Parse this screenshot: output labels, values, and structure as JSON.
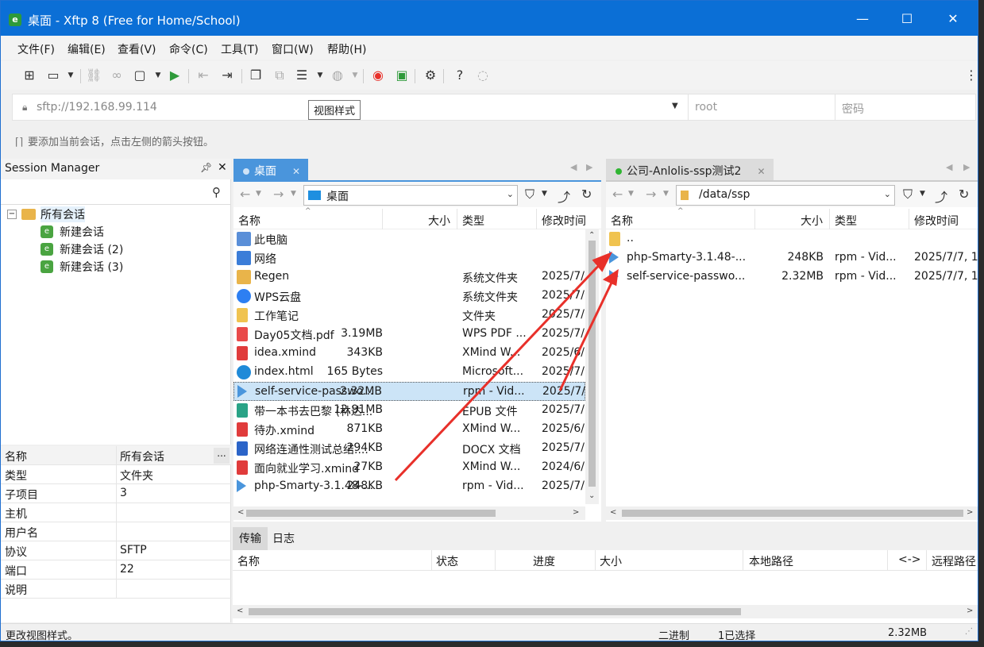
{
  "window": {
    "title": "桌面 - Xftp 8 (Free for Home/School)",
    "minimize": "—",
    "maximize": "☐",
    "close": "✕"
  },
  "menu": [
    "文件(F)",
    "编辑(E)",
    "查看(V)",
    "命令(C)",
    "工具(T)",
    "窗口(W)",
    "帮助(H)"
  ],
  "toolbar": {
    "tooltip": "视图样式"
  },
  "address": {
    "host": "sftp://192.168.99.114",
    "user_placeholder": "root",
    "password_placeholder": "密码"
  },
  "hint": "要添加当前会话，点击左侧的箭头按钮。",
  "session_manager": {
    "title": "Session Manager",
    "tree": {
      "root": "所有会话",
      "items": [
        "新建会话",
        "新建会话 (2)",
        "新建会话 (3)"
      ]
    }
  },
  "properties": {
    "header": {
      "key": "名称",
      "value": "所有会话",
      "more": "..."
    },
    "rows": [
      {
        "key": "类型",
        "value": "文件夹"
      },
      {
        "key": "子项目",
        "value": "3"
      },
      {
        "key": "主机",
        "value": ""
      },
      {
        "key": "用户名",
        "value": ""
      },
      {
        "key": "协议",
        "value": "SFTP"
      },
      {
        "key": "端口",
        "value": "22"
      },
      {
        "key": "说明",
        "value": ""
      }
    ]
  },
  "local": {
    "tab": "桌面",
    "path": "桌面",
    "columns": [
      "名称",
      "大小",
      "类型",
      "修改时间"
    ],
    "files": [
      {
        "name": "此电脑",
        "size": "",
        "type": "",
        "date": "",
        "icon": "pc-icon"
      },
      {
        "name": "网络",
        "size": "",
        "type": "",
        "date": "",
        "icon": "network-icon"
      },
      {
        "name": "Regen",
        "size": "",
        "type": "系统文件夹",
        "date": "2025/7/",
        "icon": "user-folder-icon"
      },
      {
        "name": "WPS云盘",
        "size": "",
        "type": "系统文件夹",
        "date": "2025/7/",
        "icon": "cloud-icon"
      },
      {
        "name": "工作笔记",
        "size": "",
        "type": "文件夹",
        "date": "2025/7/",
        "icon": "folder-icon"
      },
      {
        "name": "Day05文档.pdf",
        "size": "3.19MB",
        "type": "WPS PDF ...",
        "date": "2025/7/",
        "icon": "pdf-icon"
      },
      {
        "name": "idea.xmind",
        "size": "343KB",
        "type": "XMind W...",
        "date": "2025/6/",
        "icon": "xmind-icon"
      },
      {
        "name": "index.html",
        "size": "165 Bytes",
        "type": "Microsoft...",
        "date": "2025/7/",
        "icon": "edge-icon"
      },
      {
        "name": "self-service-passwo...",
        "size": "2.32MB",
        "type": "rpm - Vid...",
        "date": "2025/7/",
        "icon": "rpm-icon"
      },
      {
        "name": "带一本书去巴黎 (林达...",
        "size": "12.91MB",
        "type": "EPUB 文件",
        "date": "2025/7/",
        "icon": "epub-icon"
      },
      {
        "name": "待办.xmind",
        "size": "871KB",
        "type": "XMind W...",
        "date": "2025/6/",
        "icon": "xmind-icon"
      },
      {
        "name": "网络连通性测试总结....",
        "size": "294KB",
        "type": "DOCX 文档",
        "date": "2025/7/",
        "icon": "word-icon"
      },
      {
        "name": "面向就业学习.xmind",
        "size": "27KB",
        "type": "XMind W...",
        "date": "2024/6/",
        "icon": "xmind-icon"
      },
      {
        "name": "php-Smarty-3.1.48-...",
        "size": "248KB",
        "type": "rpm - Vid...",
        "date": "2025/7/",
        "icon": "rpm-icon"
      }
    ]
  },
  "remote": {
    "tab": "公司-Anlolis-ssp测试2",
    "path": "/data/ssp",
    "columns": [
      "名称",
      "大小",
      "类型",
      "修改时间"
    ],
    "files": [
      {
        "name": "..",
        "size": "",
        "type": "",
        "date": "",
        "icon": "folder-icon"
      },
      {
        "name": "php-Smarty-3.1.48-...",
        "size": "248KB",
        "type": "rpm - Vid...",
        "date": "2025/7/7, 1",
        "icon": "rpm-icon"
      },
      {
        "name": "self-service-passwo...",
        "size": "2.32MB",
        "type": "rpm - Vid...",
        "date": "2025/7/7, 1",
        "icon": "rpm-icon"
      }
    ]
  },
  "transfer": {
    "tabs": [
      "传输",
      "日志"
    ],
    "columns": [
      "名称",
      "状态",
      "进度",
      "大小",
      "本地路径",
      "<->",
      "远程路径"
    ]
  },
  "status": {
    "message": "更改视图样式。",
    "mode": "二进制",
    "selected": "1已选择",
    "size": "2.32MB"
  },
  "colors": {
    "titlebar": "#0b6fd6",
    "accent": "#4a95dc",
    "arrow": "#e8302a",
    "selection": "#cce4f7"
  }
}
